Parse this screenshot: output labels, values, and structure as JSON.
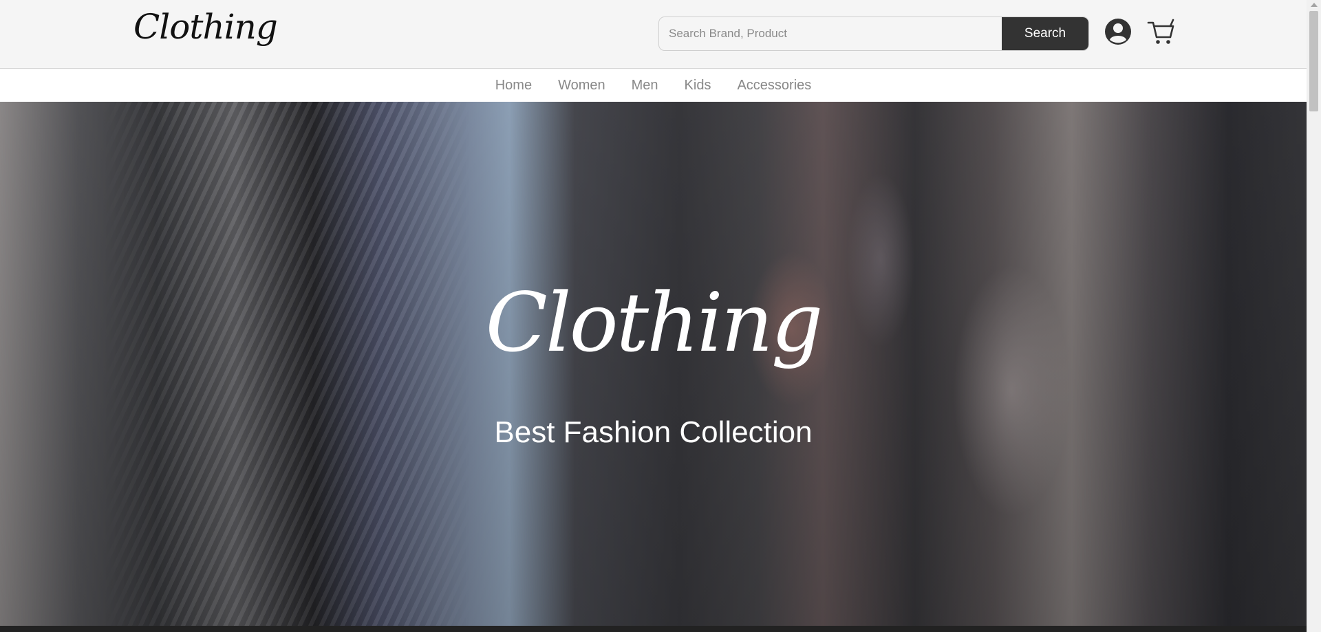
{
  "header": {
    "logo": "Clothing",
    "search": {
      "placeholder": "Search Brand, Product",
      "value": "",
      "button_label": "Search"
    },
    "icons": [
      "user-account-icon",
      "shopping-cart-icon"
    ]
  },
  "nav": {
    "items": [
      {
        "label": "Home"
      },
      {
        "label": "Women"
      },
      {
        "label": "Men"
      },
      {
        "label": "Kids"
      },
      {
        "label": "Accessories"
      }
    ]
  },
  "hero": {
    "logo": "Clothing",
    "tagline": "Best Fashion Collection"
  },
  "colors": {
    "header_bg": "#f5f5f5",
    "button_bg": "#333333",
    "nav_text": "#888888",
    "hero_text": "#ffffff"
  }
}
